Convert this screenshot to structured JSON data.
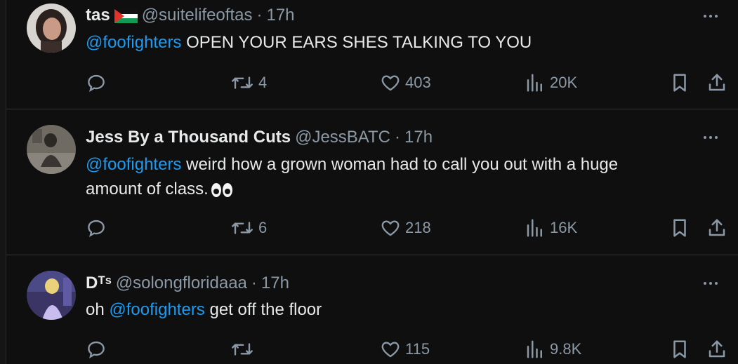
{
  "tweets": [
    {
      "name": "tas",
      "has_flag": true,
      "handle": "@suitelifeoftas",
      "separator": "·",
      "time": "17h",
      "mention": "@foofighters",
      "text": " OPEN YOUR EARS SHES TALKING TO YOU",
      "text2": "",
      "retweets": "4",
      "likes": "403",
      "views": "20K"
    },
    {
      "name": "Jess By a Thousand Cuts",
      "handle": "@JessBATC",
      "separator": "·",
      "time": "17h",
      "mention": "@foofighters",
      "text": " weird how a grown woman had to call you out with a huge",
      "text2": "amount of class.",
      "emoji": "eyes",
      "retweets": "6",
      "likes": "218",
      "views": "16K"
    },
    {
      "name": "Dᵀˢ",
      "handle": "@solongfloridaaa",
      "separator": "·",
      "time": "17h",
      "prefix": "oh ",
      "mention": "@foofighters",
      "text": " get off the floor",
      "retweets": "",
      "likes": "115",
      "views": "9.8K"
    }
  ],
  "icons": {
    "reply": "reply-icon",
    "retweet": "retweet-icon",
    "like": "heart-icon",
    "views": "views-icon",
    "bookmark": "bookmark-icon",
    "share": "share-icon",
    "more": "more-icon"
  },
  "colors": {
    "background": "#0f0f0f",
    "text": "#e7e9ea",
    "muted": "#8b98a5",
    "mention": "#1d9bf0"
  }
}
